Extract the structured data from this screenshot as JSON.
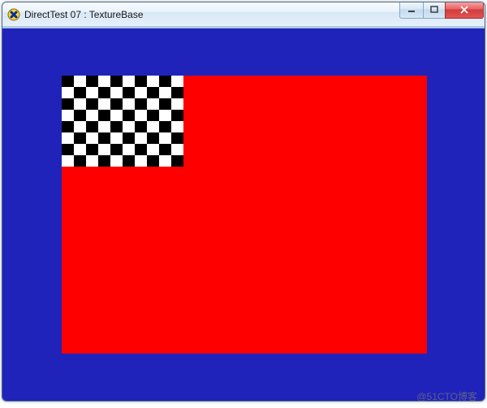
{
  "window": {
    "title": "DirectTest 07 : TextureBase",
    "buttons": {
      "minimize": "minimize",
      "maximize": "maximize",
      "close": "close"
    }
  },
  "scene": {
    "background_color": "#1f23ba",
    "rect_color": "#ff0000",
    "texture": {
      "pattern": "checker",
      "cols": 10,
      "rows": 8,
      "color_a": "#000000",
      "color_b": "#ffffff"
    }
  },
  "watermark": "@51CTO博客"
}
